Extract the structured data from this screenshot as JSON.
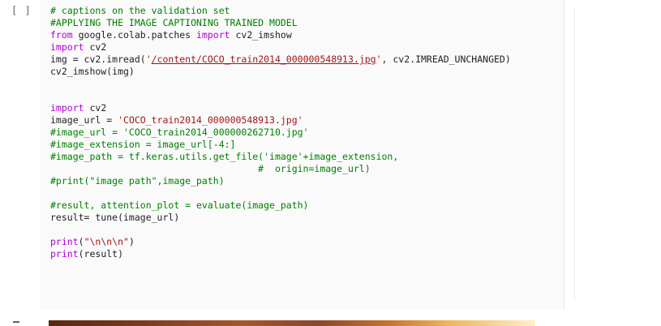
{
  "cell": {
    "run_indicator": "[ ]",
    "lines": [
      [
        {
          "t": "# captions on the validation set",
          "c": "comment"
        }
      ],
      [
        {
          "t": "#APPLYING THE IMAGE CAPTIONING TRAINED MODEL",
          "c": "comment"
        }
      ],
      [
        {
          "t": "from",
          "c": "kw"
        },
        {
          "t": " google.colab.patches ",
          "c": ""
        },
        {
          "t": "import",
          "c": "kw"
        },
        {
          "t": " cv2_imshow",
          "c": ""
        }
      ],
      [
        {
          "t": "import",
          "c": "kw"
        },
        {
          "t": " cv2",
          "c": ""
        }
      ],
      [
        {
          "t": "img = cv2.imread(",
          "c": ""
        },
        {
          "t": "'",
          "c": "str"
        },
        {
          "t": "/content/COCO_train2014_000000548913.jpg",
          "c": "link"
        },
        {
          "t": "'",
          "c": "str"
        },
        {
          "t": ", cv2.IMREAD_UNCHANGED)",
          "c": ""
        }
      ],
      [
        {
          "t": "cv2_imshow(img)",
          "c": ""
        }
      ],
      [],
      [],
      [
        {
          "t": "import",
          "c": "kw"
        },
        {
          "t": " cv2",
          "c": ""
        }
      ],
      [
        {
          "t": "image_url = ",
          "c": ""
        },
        {
          "t": "'COCO_train2014_000000548913.jpg'",
          "c": "str"
        }
      ],
      [
        {
          "t": "#image_url = 'COCO_train2014_000000262710.jpg'",
          "c": "comment"
        }
      ],
      [
        {
          "t": "#image_extension = image_url[-4:]",
          "c": "comment"
        }
      ],
      [
        {
          "t": "#image_path = tf.keras.utils.get_file('image'+image_extension,",
          "c": "comment"
        }
      ],
      [
        {
          "t": "                                     #  origin=image_url)",
          "c": "comment"
        }
      ],
      [
        {
          "t": "#print(\"image path\",image_path)",
          "c": "comment"
        }
      ],
      [],
      [
        {
          "t": "#result, attention_plot = evaluate(image_path)",
          "c": "comment"
        }
      ],
      [
        {
          "t": "result= tune(image_url)",
          "c": ""
        }
      ],
      [],
      [
        {
          "t": "print",
          "c": "kw"
        },
        {
          "t": "(",
          "c": ""
        },
        {
          "t": "\"\\n\\n\\n\"",
          "c": "str"
        },
        {
          "t": ")",
          "c": ""
        }
      ],
      [
        {
          "t": "print",
          "c": "kw"
        },
        {
          "t": "(result)",
          "c": ""
        }
      ]
    ]
  },
  "output": {
    "icon": "output-collapse-icon",
    "image": "output-image"
  }
}
